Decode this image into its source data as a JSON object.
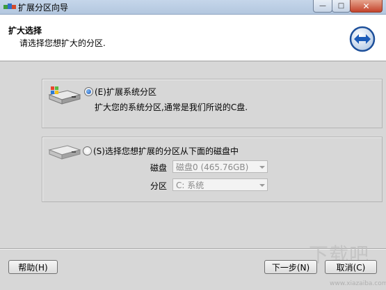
{
  "window": {
    "title": "扩展分区向导",
    "min_label": "—",
    "max_label": "□",
    "close_label": "✕"
  },
  "header": {
    "title": "扩大选择",
    "subtitle": "请选择您想扩大的分区."
  },
  "option1": {
    "label": "(E)扩展系统分区",
    "description": "扩大您的系统分区,通常是我们所说的C盘.",
    "selected": true
  },
  "option2": {
    "label": "(S)选择您想扩展的分区从下面的磁盘中",
    "selected": false,
    "disk_label": "磁盘",
    "disk_value": "磁盘0 (465.76GB)",
    "partition_label": "分区",
    "partition_value": "C: 系统"
  },
  "buttons": {
    "help": "帮助(H)",
    "next": "下一步(N)",
    "cancel": "取消(C)"
  },
  "watermark": {
    "text": "下载吧",
    "url": "www.xiazaiba.com"
  },
  "colors": {
    "title_bar": "#b9cce3",
    "background": "#d7d7d7",
    "radio_selected": "#1b56b5",
    "close_button": "#c4432b"
  }
}
